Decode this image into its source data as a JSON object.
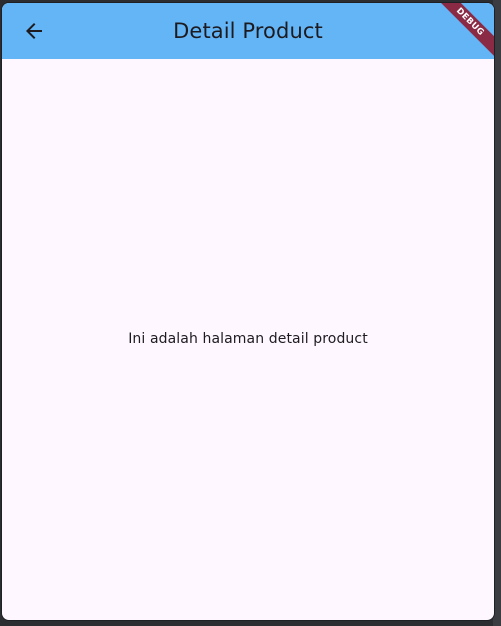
{
  "appbar": {
    "title": "Detail Product",
    "back_icon": "arrow-back-icon",
    "background": "#64b5f6"
  },
  "debug_banner": {
    "label": "DEBUG",
    "color": "#8b2a45"
  },
  "content": {
    "message": "Ini adalah halaman detail product",
    "background": "#fef7ff"
  }
}
